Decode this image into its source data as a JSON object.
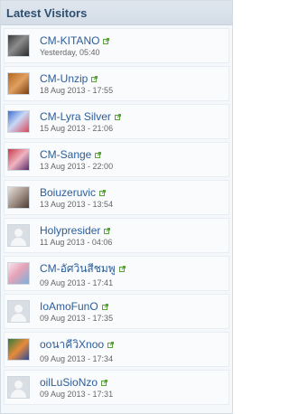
{
  "widget": {
    "title": "Latest Visitors"
  },
  "visitors": [
    {
      "name": "CM-KITANO",
      "time": "Yesterday, 05:40",
      "avatar": "photo"
    },
    {
      "name": "CM-Unzip",
      "time": "18 Aug 2013 - 17:55",
      "avatar": "photo"
    },
    {
      "name": "CM-Lyra Silver",
      "time": "15 Aug 2013 - 21:06",
      "avatar": "photo"
    },
    {
      "name": "CM-Sange",
      "time": "13 Aug 2013 - 22:00",
      "avatar": "photo"
    },
    {
      "name": "Boiuzeruvic",
      "time": "13 Aug 2013 - 13:54",
      "avatar": "photo"
    },
    {
      "name": "Holypresider",
      "time": "11 Aug 2013 - 04:06",
      "avatar": "default"
    },
    {
      "name": "CM-อัศวินสีชมพู",
      "time": "09 Aug 2013 - 17:41",
      "avatar": "photo"
    },
    {
      "name": "IoAmoFunO",
      "time": "09 Aug 2013 - 17:35",
      "avatar": "default"
    },
    {
      "name": "ooนาคีวิXnoo",
      "time": "09 Aug 2013 - 17:34",
      "avatar": "photo"
    },
    {
      "name": "oilLuSioNzo",
      "time": "09 Aug 2013 - 17:31",
      "avatar": "default"
    }
  ],
  "colors": {
    "name_link": "#2c5d99",
    "external_icon": "#5aa33a",
    "header_text": "#2f4f6f"
  },
  "icons": {
    "external_link": "external-link-icon",
    "default_avatar": "default-avatar-icon"
  }
}
